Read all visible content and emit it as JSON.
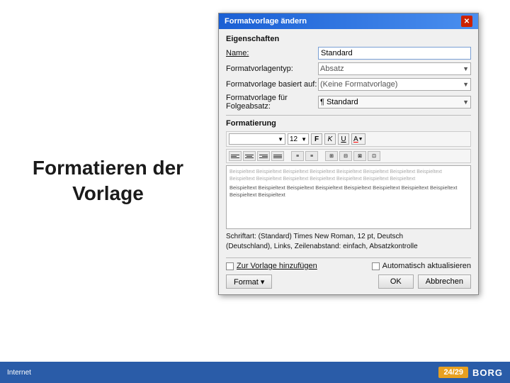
{
  "slide": {
    "title_line1": "Formatieren der",
    "title_line2": "Vorlage"
  },
  "dialog": {
    "title": "Formatvorlage ändern",
    "close_btn": "✕",
    "sections": {
      "eigenschaften": "Eigenschaften",
      "formatierung": "Formatierung"
    },
    "fields": {
      "name_label": "Name:",
      "name_value": "Standard",
      "formatvorlagentyp_label": "Formatvorlagentyp:",
      "formatvorlagentyp_value": "Absatz",
      "basiert_label": "Formatvorlage basiert auf:",
      "basiert_value": "(Keine Formatvorlage)",
      "folgeabsatz_label": "Formatvorlage für Folgeabsatz:",
      "folgeabsatz_value": "¶ Standard"
    },
    "toolbar": {
      "font_placeholder": "",
      "size_value": "12",
      "bold": "F",
      "italic": "K",
      "underline": "U",
      "color": "A"
    },
    "preview": {
      "text_gray": "Beispieltext Beispieltext Beispieltext Beispieltext Beispieltext Beispieltext Beispieltext Beispieltext Beispieltext Beispieltext Beispieltext Beispieltext Beispieltext Beispieltext Beispieltext",
      "text_dark": "Beispieltext Beispieltext Beispieltext Beispieltext Beispieltext Beispieltext Beispieltext Beispieltext Beispieltext Beispieltext"
    },
    "description": "Schriftart: (Standard) Times New Roman, 12 pt, Deutsch\n(Deutschland), Links, Zeilenabstand: einfach, Absatzkontrolle",
    "checkboxes": {
      "hinzufuegen_label": "Zur Vorlage hinzufügen",
      "aktualisieren_label": "Automatisch aktualisieren"
    },
    "buttons": {
      "format_label": "Format ▾",
      "ok_label": "OK",
      "cancel_label": "Abbrechen"
    }
  },
  "bottom": {
    "internet_label": "Internet",
    "page_current": "24",
    "page_total": "29",
    "logo": "BORG"
  }
}
